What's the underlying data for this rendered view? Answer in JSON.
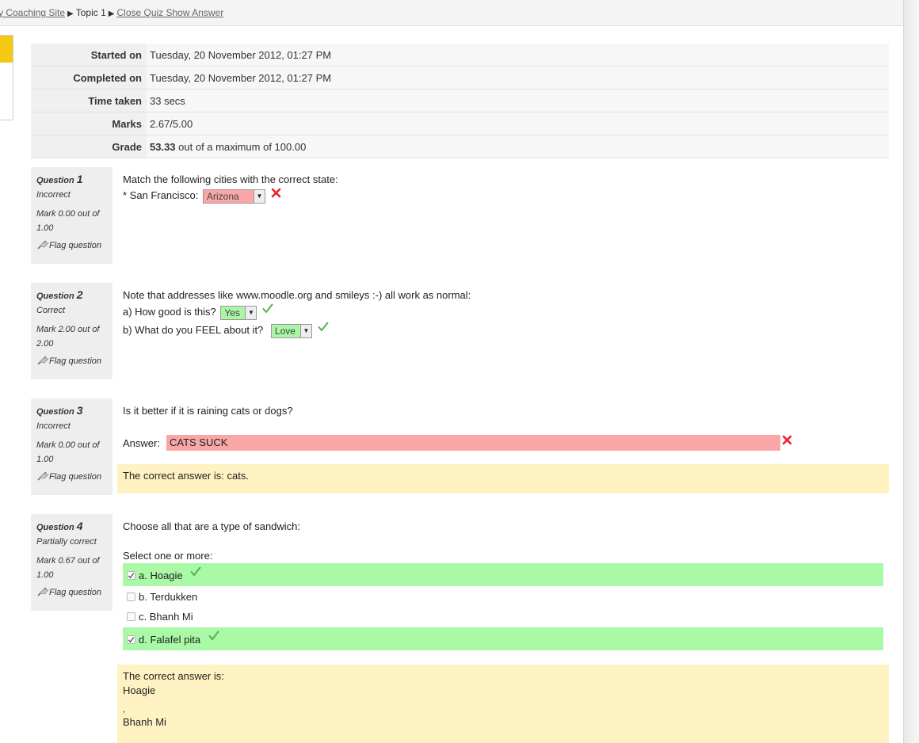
{
  "breadcrumb": {
    "site": "y Coaching Site",
    "topic": "Topic 1",
    "current": "Close Quiz Show Answer"
  },
  "summary": [
    {
      "label": "Started on",
      "value": "Tuesday, 20 November 2012, 01:27 PM"
    },
    {
      "label": "Completed on",
      "value": "Tuesday, 20 November 2012, 01:27 PM"
    },
    {
      "label": "Time taken",
      "value": "33 secs"
    },
    {
      "label": "Marks",
      "value": "2.67/5.00"
    },
    {
      "label": "Grade",
      "value_bold": "53.33",
      "value_rest": " out of a maximum of 100.00"
    }
  ],
  "questions": [
    {
      "prefix": "Question",
      "number": "1",
      "state": "Incorrect",
      "mark": "Mark 0.00 out of 1.00",
      "flag": "Flag question",
      "text": "Match the following cities with the correct state:",
      "line_label": "* San Francisco:",
      "select_value": "Arizona"
    },
    {
      "prefix": "Question",
      "number": "2",
      "state": "Correct",
      "mark": "Mark 2.00 out of 2.00",
      "flag": "Flag question",
      "text": "Note that addresses like www.moodle.org and smileys :-) all work as normal:",
      "items": [
        {
          "label": "a) How good is this?",
          "select_value": "Yes"
        },
        {
          "label": "b) What do you FEEL about it?",
          "select_value": "Love"
        }
      ]
    },
    {
      "prefix": "Question",
      "number": "3",
      "state": "Incorrect",
      "mark": "Mark 0.00 out of 1.00",
      "flag": "Flag question",
      "text": "Is it better if it is raining cats or dogs?",
      "answer_label": "Answer:",
      "answer_value": "CATS SUCK",
      "feedback": "The correct answer is: cats."
    },
    {
      "prefix": "Question",
      "number": "4",
      "state": "Partially correct",
      "mark": "Mark 0.67 out of 1.00",
      "flag": "Flag question",
      "text": "Choose all that are a type of sandwich:",
      "select_prompt": "Select one or more:",
      "options": [
        {
          "label": "a. Hoagie",
          "checked": true
        },
        {
          "label": "b. Terdukken",
          "checked": false
        },
        {
          "label": "c. Bhanh Mi",
          "checked": false
        },
        {
          "label": "d. Falafel pita",
          "checked": true
        }
      ],
      "feedback_title": "The correct answer is:",
      "feedback_lines": [
        "Hoagie",
        ",",
        "Bhanh Mi"
      ]
    }
  ],
  "colors": {
    "incorrect": "#f8a6a6",
    "correct": "#a9f9a6",
    "feedback": "#fff2c2",
    "cross": "#e8242c",
    "tick": "#52b24a"
  },
  "icons": [
    "flag-icon",
    "cross-icon",
    "tick-icon",
    "dropdown-arrow-icon"
  ]
}
